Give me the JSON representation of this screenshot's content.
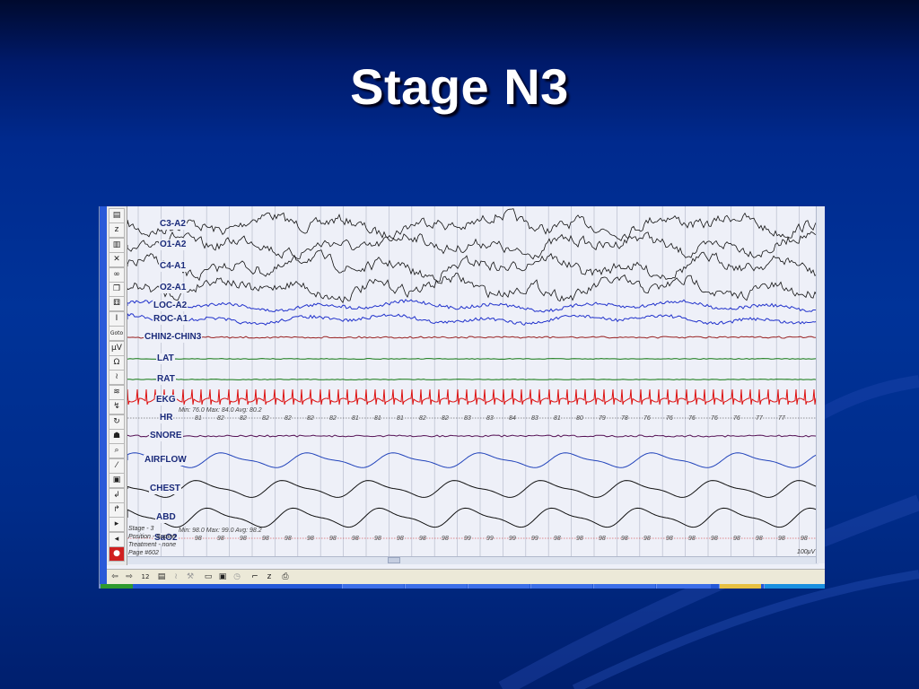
{
  "slide": {
    "title": "Stage N3"
  },
  "psg": {
    "channels": [
      {
        "label": "C3-A2",
        "color": "#111111"
      },
      {
        "label": "O1-A2",
        "color": "#111111"
      },
      {
        "label": "C4-A1",
        "color": "#111111"
      },
      {
        "label": "O2-A1",
        "color": "#111111"
      },
      {
        "label": "LOC-A2",
        "color": "#2233cc"
      },
      {
        "label": "ROC-A1",
        "color": "#2233cc"
      },
      {
        "label": "CHIN2-CHIN3",
        "color": "#992222"
      },
      {
        "label": "LAT",
        "color": "#117711"
      },
      {
        "label": "RAT",
        "color": "#117711"
      },
      {
        "label": "EKG",
        "color": "#dd1111"
      },
      {
        "label": "HR",
        "color": "#333333"
      },
      {
        "label": "SNORE",
        "color": "#551155"
      },
      {
        "label": "AIRFLOW",
        "color": "#2244bb"
      },
      {
        "label": "CHEST",
        "color": "#111111"
      },
      {
        "label": "ABD",
        "color": "#111111"
      },
      {
        "label": "SaO2",
        "color": "#cc2222"
      }
    ],
    "hr_stats": "Min: 76.0 Max: 84.0 Avg: 80.2",
    "hr_values": [
      "81",
      "82",
      "82",
      "82",
      "82",
      "82",
      "82",
      "81",
      "81",
      "81",
      "82",
      "82",
      "83",
      "83",
      "84",
      "83",
      "81",
      "80",
      "79",
      "78",
      "76",
      "76",
      "76",
      "76",
      "76",
      "77",
      "77"
    ],
    "sao2_stats": "Min: 98.0 Max: 99.0 Avg: 98.2",
    "sao2_values": [
      "98",
      "98",
      "98",
      "98",
      "98",
      "98",
      "98",
      "98",
      "98",
      "98",
      "98",
      "98",
      "99",
      "99",
      "99",
      "99",
      "98",
      "98",
      "98",
      "98",
      "98",
      "98",
      "98",
      "98",
      "98",
      "98",
      "98",
      "98"
    ],
    "info": {
      "stage": "Stage - 3",
      "position": "Position - Supine",
      "treatment": "Treatment - none",
      "page": "Page #602"
    },
    "scale_label": "100μV",
    "status_bar": {
      "page_count": "12"
    }
  },
  "icons": {
    "toolbar": [
      "document-icon",
      "z-icon",
      "ruler-icon",
      "close-x-icon",
      "glasses-icon",
      "page-icon",
      "dice-icon",
      "cursor-icon",
      "goto-icon",
      "microvolt-icon",
      "omega-icon",
      "wave-icon",
      "double-wave-icon",
      "filter-icon",
      "refresh-icon",
      "people-icon",
      "zoom-icon",
      "pen-icon",
      "camera-icon",
      "arrow-in-icon",
      "arrow-out-icon",
      "arrow-right-icon",
      "arrow-left-icon",
      "record-icon"
    ],
    "toolbar_glyphs": [
      "▤",
      "z",
      "▥",
      "✕",
      "∞",
      "❐",
      "⚅",
      "I",
      "Goto",
      "μV",
      "Ω",
      "≀",
      "≋",
      "↯",
      "↻",
      "☗",
      "⌕",
      "⁄",
      "▣",
      "↲",
      "↱",
      "▸",
      "◂",
      "●"
    ]
  }
}
